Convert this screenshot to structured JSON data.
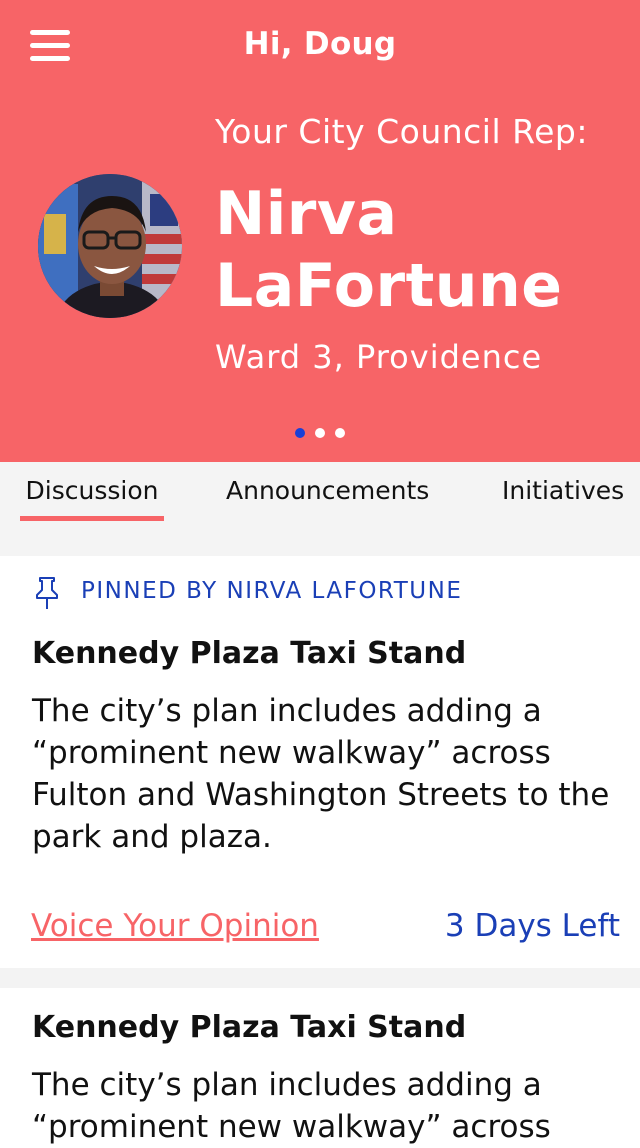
{
  "header": {
    "greeting": "Hi, Doug",
    "rep_label": "Your City Council Rep:",
    "rep_name_line1": "Nirva",
    "rep_name_line2": "LaFortune",
    "rep_ward": "Ward 3, Providence",
    "carousel": {
      "count": 3,
      "active_index": 0
    }
  },
  "tabs": [
    {
      "label": "Discussion",
      "selected": true
    },
    {
      "label": "Announcements",
      "selected": false
    },
    {
      "label": "Initiatives",
      "selected": false
    }
  ],
  "posts": [
    {
      "pinned_label": "PINNED BY NIRVA LAFORTUNE",
      "title": "Kennedy Plaza Taxi Stand",
      "body": "The city’s plan includes adding a “prominent new walkway” across Fulton and Washington Streets to the park and plaza.",
      "action_label": "Voice Your Opinion",
      "deadline": "3 Days Left"
    },
    {
      "title": "Kennedy Plaza Taxi Stand",
      "body": "The city’s plan includes adding a “prominent new walkway” across"
    }
  ],
  "colors": {
    "accent": "#f76467",
    "link_blue": "#1a3fb6",
    "dot_active": "#1a3fd6"
  },
  "icons": {
    "menu": "hamburger-menu-icon",
    "pinned": "pushpin-icon"
  }
}
